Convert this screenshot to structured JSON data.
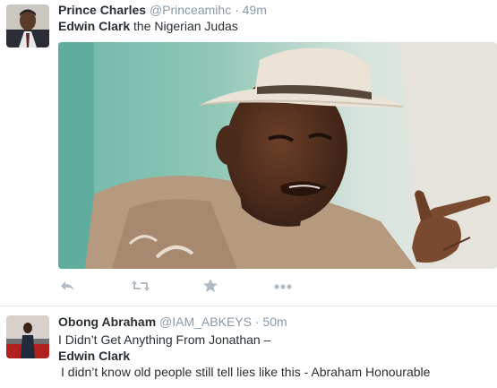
{
  "tweets": [
    {
      "name": "Prince Charles",
      "handle": "@Princeamihc",
      "separator": "·",
      "time": "49m",
      "text_bold": "Edwin Clark",
      "text_rest": " the Nigerian Judas",
      "actions": [
        "reply-icon",
        "retweet-icon",
        "favorite-icon",
        "more-icon"
      ]
    },
    {
      "name": "Obong Abraham",
      "handle": "@IAM_ABKEYS",
      "separator": "·",
      "time": "50m",
      "line1": "I Didn’t Get Anything From Jonathan –",
      "line2": "Edwin Clark",
      "line3": "I didn’t know old people still tell lies like this - Abraham Honourable"
    }
  ],
  "colors": {
    "name": "#292f33",
    "meta": "#8899a6",
    "action_icon": "#b1bbc3",
    "divider": "#e1e8ed"
  }
}
